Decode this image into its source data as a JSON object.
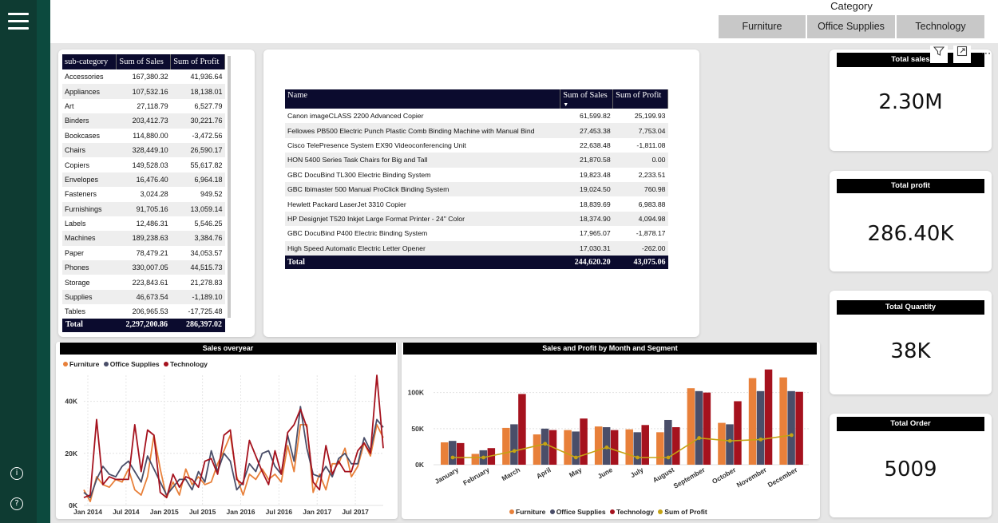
{
  "category_slicer": {
    "title": "Category",
    "options": [
      "Furniture",
      "Office Supplies",
      "Technology"
    ]
  },
  "subcategory_table": {
    "headers": [
      "sub-category",
      "Sum of Sales",
      "Sum of Profit"
    ],
    "rows": [
      [
        "Accessories",
        "167,380.32",
        "41,936.64"
      ],
      [
        "Appliances",
        "107,532.16",
        "18,138.01"
      ],
      [
        "Art",
        "27,118.79",
        "6,527.79"
      ],
      [
        "Binders",
        "203,412.73",
        "30,221.76"
      ],
      [
        "Bookcases",
        "114,880.00",
        "-3,472.56"
      ],
      [
        "Chairs",
        "328,449.10",
        "26,590.17"
      ],
      [
        "Copiers",
        "149,528.03",
        "55,617.82"
      ],
      [
        "Envelopes",
        "16,476.40",
        "6,964.18"
      ],
      [
        "Fasteners",
        "3,024.28",
        "949.52"
      ],
      [
        "Furnishings",
        "91,705.16",
        "13,059.14"
      ],
      [
        "Labels",
        "12,486.31",
        "5,546.25"
      ],
      [
        "Machines",
        "189,238.63",
        "3,384.76"
      ],
      [
        "Paper",
        "78,479.21",
        "34,053.57"
      ],
      [
        "Phones",
        "330,007.05",
        "44,515.73"
      ],
      [
        "Storage",
        "223,843.61",
        "21,278.83"
      ],
      [
        "Supplies",
        "46,673.54",
        "-1,189.10"
      ],
      [
        "Tables",
        "206,965.53",
        "-17,725.48"
      ]
    ],
    "total": [
      "Total",
      "2,297,200.86",
      "286,397.02"
    ]
  },
  "product_table": {
    "headers": [
      "Name",
      "Sum of Sales",
      "Sum of Profit"
    ],
    "rows": [
      [
        "Canon imageCLASS 2200 Advanced Copier",
        "61,599.82",
        "25,199.93"
      ],
      [
        "Fellowes PB500 Electric Punch Plastic Comb Binding Machine with Manual Bind",
        "27,453.38",
        "7,753.04"
      ],
      [
        "Cisco TelePresence System EX90 Videoconferencing Unit",
        "22,638.48",
        "-1,811.08"
      ],
      [
        "HON 5400 Series Task Chairs for Big and Tall",
        "21,870.58",
        "0.00"
      ],
      [
        "GBC DocuBind TL300 Electric Binding System",
        "19,823.48",
        "2,233.51"
      ],
      [
        "GBC Ibimaster 500 Manual ProClick Binding System",
        "19,024.50",
        "760.98"
      ],
      [
        "Hewlett Packard LaserJet 3310 Copier",
        "18,839.69",
        "6,983.88"
      ],
      [
        "HP Designjet T520 Inkjet Large Format Printer - 24\" Color",
        "18,374.90",
        "4,094.98"
      ],
      [
        "GBC DocuBind P400 Electric Binding System",
        "17,965.07",
        "-1,878.17"
      ],
      [
        "High Speed Automatic Electric Letter Opener",
        "17,030.31",
        "-262.00"
      ]
    ],
    "total": [
      "Total",
      "244,620.20",
      "43,075.06"
    ]
  },
  "kpis": [
    {
      "label": "Total sales",
      "value": "2.30M"
    },
    {
      "label": "Total profit",
      "value": "286.40K"
    },
    {
      "label": "Total Quantity",
      "value": "38K"
    },
    {
      "label": "Total Order",
      "value": "5009"
    }
  ],
  "colors": {
    "furniture": "#e8803a",
    "office_supplies": "#4a4e69",
    "technology": "#a5121e",
    "profit": "#c5a313",
    "header_bg": "#0b0b2e",
    "nav_bg": "#0e3b32"
  },
  "chart_data": [
    {
      "type": "line",
      "title": "Sales overyear",
      "x_ticks": [
        "Jan 2014",
        "Jul 2014",
        "Jan 2015",
        "Jul 2015",
        "Jan 2016",
        "Jul 2016",
        "Jan 2017",
        "Jul 2017"
      ],
      "y_ticks": [
        "0K",
        "20K",
        "40K"
      ],
      "ylim": [
        0,
        50000
      ],
      "grid": true,
      "legend_position": "top-left",
      "series": [
        {
          "name": "Furniture",
          "values": [
            6000,
            1500,
            11000,
            8000,
            7000,
            10000,
            9000,
            14000,
            6000,
            4000,
            11000,
            27000,
            14000,
            3000,
            9000,
            4000,
            14000,
            8000,
            11000,
            8000,
            9000,
            16000,
            21000,
            27000,
            11000,
            4000,
            12000,
            10000,
            14000,
            10000,
            12000,
            9000,
            23000,
            13000,
            31000,
            31000,
            5000,
            12000,
            6000,
            16000,
            16000,
            22000,
            11000,
            15000,
            24000,
            19000,
            31000,
            26000
          ]
        },
        {
          "name": "Office Supplies",
          "values": [
            5000,
            3000,
            10000,
            15000,
            12000,
            11000,
            15000,
            17000,
            13000,
            9000,
            19000,
            14000,
            9000,
            4000,
            7000,
            10000,
            10000,
            6000,
            13000,
            9000,
            21000,
            13000,
            20000,
            17000,
            6000,
            9000,
            16000,
            13000,
            20000,
            21000,
            15000,
            12000,
            27000,
            17000,
            38000,
            22000,
            12000,
            11000,
            15000,
            11000,
            18000,
            20000,
            16000,
            16000,
            26000,
            21000,
            33000,
            30000
          ]
        },
        {
          "name": "Technology",
          "values": [
            3000,
            4000,
            33000,
            8000,
            11000,
            10000,
            10000,
            10000,
            31000,
            13000,
            29000,
            27000,
            5000,
            3000,
            12000,
            7000,
            11000,
            10000,
            7000,
            17000,
            18000,
            12000,
            27000,
            29000,
            10000,
            8000,
            25000,
            19000,
            13000,
            8000,
            21000,
            12000,
            28000,
            31000,
            37000,
            30000,
            9000,
            6000,
            23000,
            12000,
            17000,
            13000,
            13000,
            21000,
            24000,
            20000,
            50000,
            22000
          ]
        }
      ]
    },
    {
      "type": "bar",
      "title": "Sales and Profit by Month and Segment",
      "categories": [
        "January",
        "February",
        "March",
        "April",
        "May",
        "June",
        "July",
        "August",
        "September",
        "October",
        "November",
        "December"
      ],
      "y_ticks": [
        "0K",
        "50K",
        "100K"
      ],
      "ylim": [
        0,
        135000
      ],
      "grid": true,
      "legend_position": "bottom",
      "series": [
        {
          "name": "Furniture",
          "values": [
            31000,
            15000,
            51000,
            42000,
            48000,
            53000,
            49000,
            45000,
            106000,
            58000,
            120000,
            121000
          ]
        },
        {
          "name": "Office Supplies",
          "values": [
            33000,
            20000,
            56000,
            50000,
            46000,
            52000,
            45000,
            62000,
            102000,
            56000,
            102000,
            102000
          ]
        },
        {
          "name": "Technology",
          "values": [
            30000,
            23000,
            98000,
            48000,
            64000,
            48000,
            55000,
            52000,
            100000,
            88000,
            132000,
            101000
          ]
        },
        {
          "name": "Sum of Profit",
          "type": "line",
          "values": [
            10000,
            10000,
            19000,
            29000,
            10000,
            24000,
            10000,
            10000,
            37000,
            33000,
            35000,
            41000
          ]
        }
      ]
    }
  ]
}
